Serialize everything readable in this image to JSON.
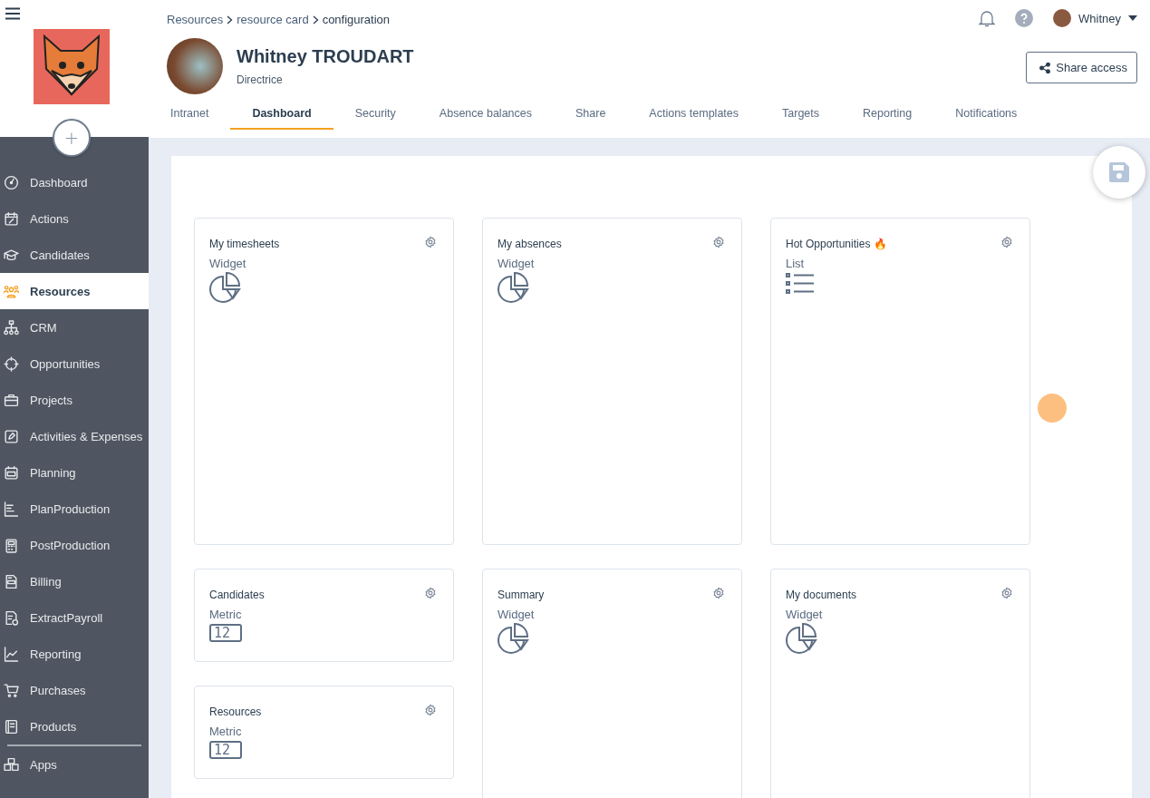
{
  "sidebar": {
    "items": [
      {
        "label": "Dashboard",
        "selected": false
      },
      {
        "label": "Actions",
        "selected": false
      },
      {
        "label": "Candidates",
        "selected": false
      },
      {
        "label": "Resources",
        "selected": true
      },
      {
        "label": "CRM",
        "selected": false
      },
      {
        "label": "Opportunities",
        "selected": false
      },
      {
        "label": "Projects",
        "selected": false
      },
      {
        "label": "Activities & Expenses",
        "selected": false
      },
      {
        "label": "Planning",
        "selected": false
      },
      {
        "label": "PlanProduction",
        "selected": false
      },
      {
        "label": "PostProduction",
        "selected": false
      },
      {
        "label": "Billing",
        "selected": false
      },
      {
        "label": "ExtractPayroll",
        "selected": false
      },
      {
        "label": "Reporting",
        "selected": false
      },
      {
        "label": "Purchases",
        "selected": false
      },
      {
        "label": "Products",
        "selected": false
      }
    ],
    "footer_items": [
      {
        "label": "Apps",
        "selected": false
      }
    ],
    "add_button": "+"
  },
  "breadcrumb": [
    "Resources",
    "resource card",
    "configuration"
  ],
  "user_menu": {
    "name": "Whitney"
  },
  "profile": {
    "name": "Whitney TROUDART",
    "role": "Directrice"
  },
  "share_button": "Share access",
  "tabs": [
    {
      "label": "Intranet",
      "selected": false
    },
    {
      "label": "Dashboard",
      "selected": true
    },
    {
      "label": "Security",
      "selected": false
    },
    {
      "label": "Absence balances",
      "selected": false
    },
    {
      "label": "Share",
      "selected": false
    },
    {
      "label": "Actions templates",
      "selected": false
    },
    {
      "label": "Targets",
      "selected": false
    },
    {
      "label": "Reporting",
      "selected": false
    },
    {
      "label": "Notifications",
      "selected": false
    }
  ],
  "cards": [
    {
      "title": "My timesheets",
      "kind": "widget",
      "type_label": "Widget"
    },
    {
      "title": "My absences",
      "kind": "widget",
      "type_label": "Widget"
    },
    {
      "title": "Hot Opportunities 🔥",
      "kind": "list",
      "type_label": "List"
    },
    {
      "title": "Candidates",
      "kind": "metric",
      "type_label": "Metric",
      "value": "12"
    },
    {
      "title": "Summary",
      "kind": "widget",
      "type_label": "Widget"
    },
    {
      "title": "My documents",
      "kind": "widget",
      "type_label": "Widget"
    },
    {
      "title": "Resources",
      "kind": "metric",
      "type_label": "Metric",
      "value": "12"
    }
  ]
}
